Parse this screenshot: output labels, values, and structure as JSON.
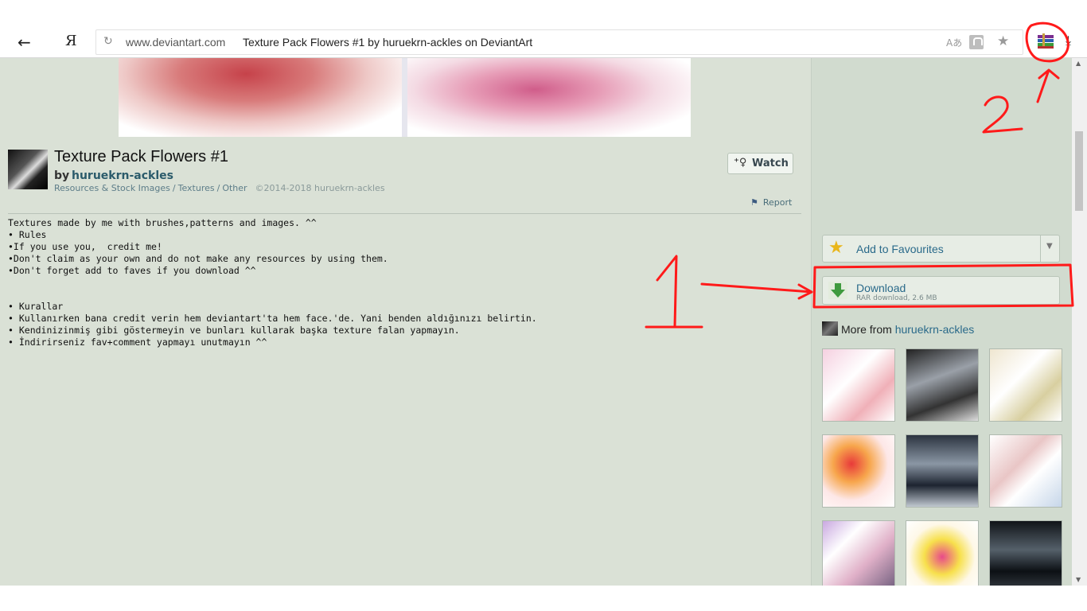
{
  "browser": {
    "back_icon": "back-arrow-icon",
    "yandex_label": "Я",
    "url_domain": "www.deviantart.com",
    "page_title": "Texture Pack Flowers #1 by huruekrn-ackles on DeviantArt"
  },
  "deviation": {
    "title": "Texture Pack Flowers #1",
    "by_label": "by",
    "author": "huruekrn-ackles",
    "breadcrumbs": [
      "Resources & Stock Images",
      "Textures",
      "Other"
    ],
    "copyright": "©2014-2018 huruekrn-ackles",
    "watch_label": "Watch",
    "report_label": "Report"
  },
  "description": {
    "lines": [
      "Textures made by me with brushes,patterns and images. ^^",
      "• Rules",
      "•If you use you,  credit me!",
      "•Don't claim as your own and do not make any resources by using them.",
      "•Don't forget add to faves if you download ^^",
      "",
      "",
      "• Kurallar",
      "• Kullanırken bana credit verin hem deviantart'ta hem face.'de. Yani benden aldığınızı belirtin.",
      "• Kendinizinmiş gibi göstermeyin ve bunları kullarak başka texture falan yapmayın.",
      "• İndirirseniz fav+comment yapmayı unutmayın ^^"
    ]
  },
  "sidebar": {
    "fav_label": "Add to Favourites",
    "download_label": "Download",
    "download_sub": "RAR download, 2.6 MB",
    "more_from_label": "More from",
    "more_from_author": "huruekrn-ackles"
  },
  "annotations": {
    "mark_1": "1",
    "mark_2": "2"
  }
}
